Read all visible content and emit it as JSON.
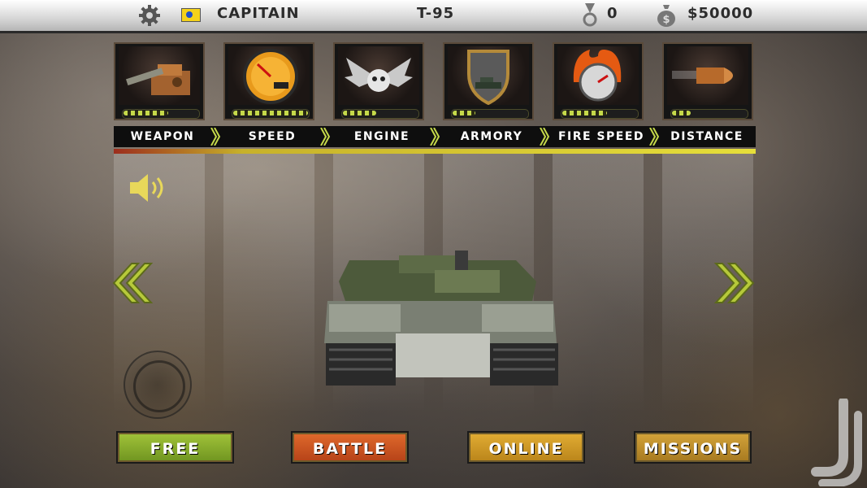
{
  "topbar": {
    "rank": "CAPITAIN",
    "tank_name": "T-95",
    "medals": "0",
    "money": "$50000",
    "icons": [
      "gear-icon",
      "flag-icon",
      "medal-icon",
      "money-bag-icon"
    ]
  },
  "upgrades": [
    {
      "label": "WEAPON",
      "level_fraction": 0.6
    },
    {
      "label": "SPEED",
      "level_fraction": 1.0
    },
    {
      "label": "ENGINE",
      "level_fraction": 0.45
    },
    {
      "label": "ARMORY",
      "level_fraction": 0.3
    },
    {
      "label": "FIRE SPEED",
      "level_fraction": 0.6
    },
    {
      "label": "DISTANCE",
      "level_fraction": 0.25
    }
  ],
  "buttons": {
    "free": "FREE",
    "battle": "BATTLE",
    "online": "ONLINE",
    "missions": "MISSIONS"
  },
  "colors": {
    "free": "#7ea42a",
    "battle": "#c8531f",
    "online": "#c9951f",
    "missions": "#b78a26",
    "accent": "#c5d94a"
  }
}
